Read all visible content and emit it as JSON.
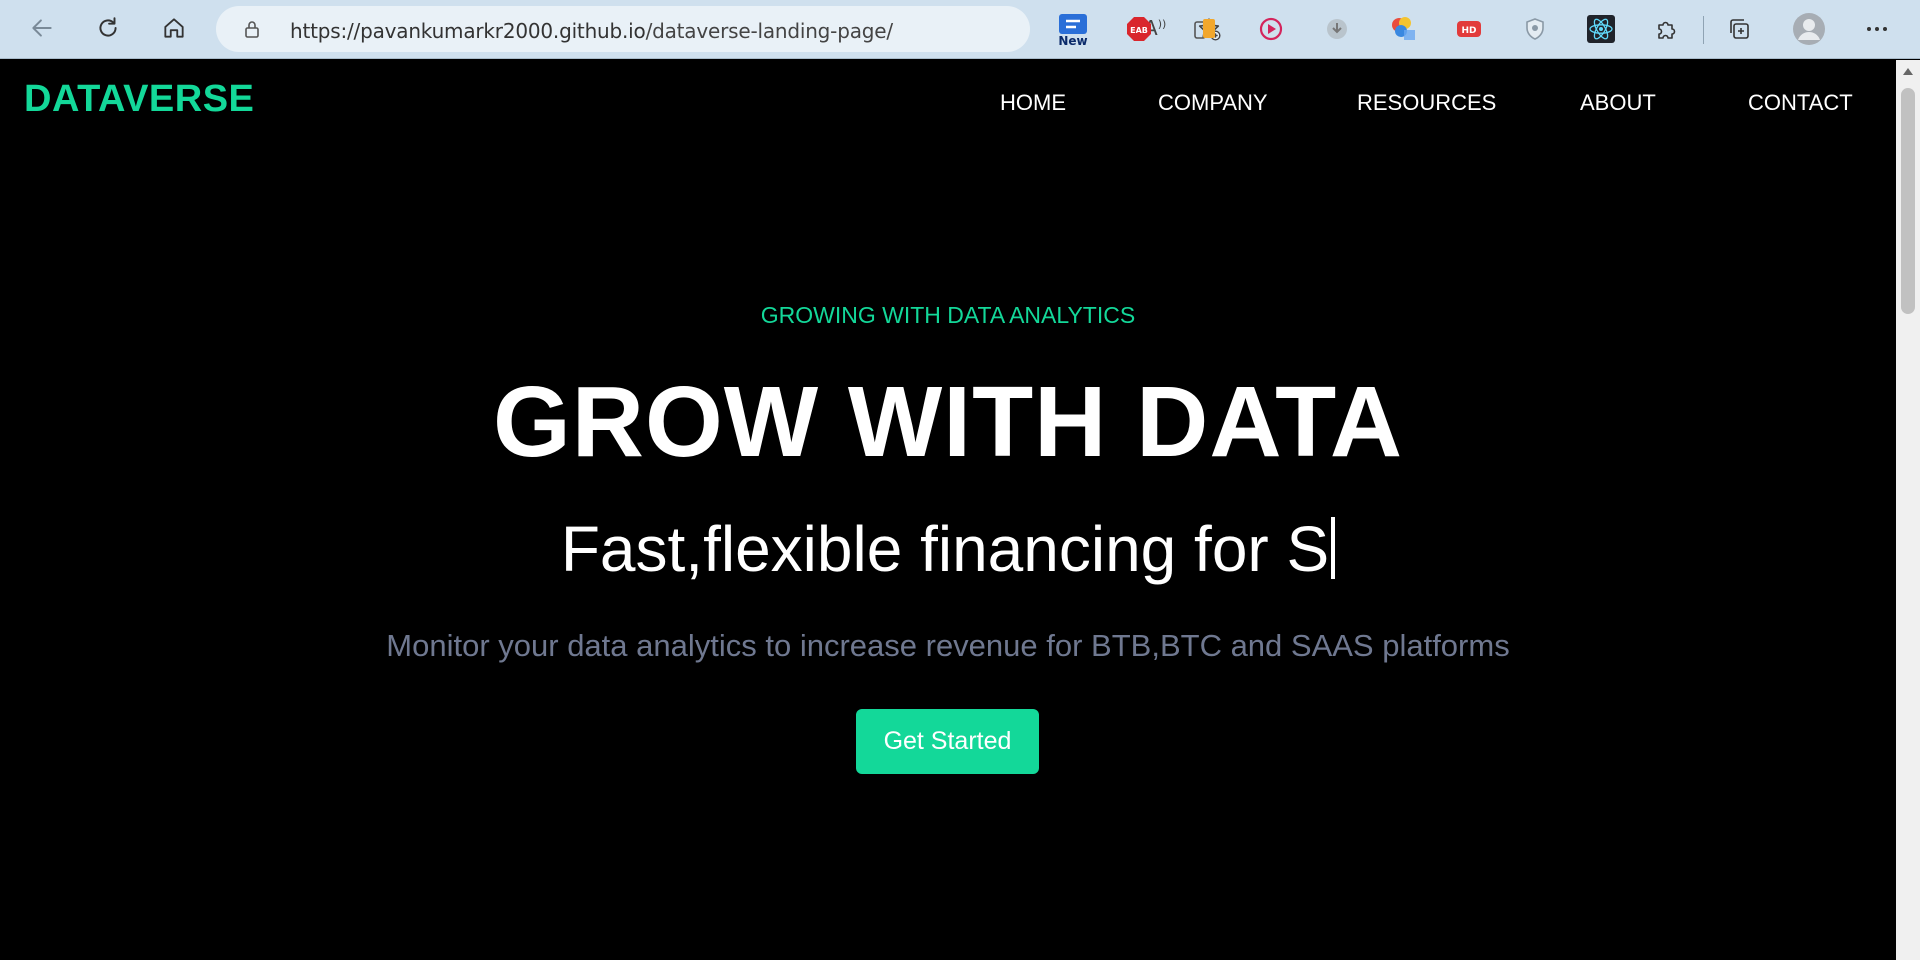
{
  "browser": {
    "url_prefix": "https://pavankumarkr2000.github.io",
    "url_path": "/dataverse-landing-page/",
    "extensions": [
      {
        "name": "new-badge-extension-icon",
        "label": "New"
      },
      {
        "name": "eab-extension-icon",
        "label": "EAB"
      },
      {
        "name": "mobile-view-extension-icon",
        "label": ""
      },
      {
        "name": "video-play-extension-icon",
        "label": ""
      },
      {
        "name": "download-extension-icon",
        "label": ""
      },
      {
        "name": "color-picker-extension-icon",
        "label": ""
      },
      {
        "name": "hd-extension-icon",
        "label": "HD"
      },
      {
        "name": "privacy-badger-extension-icon",
        "label": ""
      },
      {
        "name": "react-devtools-extension-icon",
        "label": ""
      },
      {
        "name": "extensions-puzzle-icon",
        "label": ""
      },
      {
        "name": "collections-icon",
        "label": ""
      },
      {
        "name": "profile-avatar-icon",
        "label": ""
      },
      {
        "name": "more-menu-icon",
        "label": ""
      }
    ]
  },
  "nav": {
    "logo": "DATAVERSE",
    "items": [
      "HOME",
      "COMPANY",
      "RESOURCES",
      "ABOUT",
      "CONTACT"
    ]
  },
  "hero": {
    "eyebrow": "GROWING WITH DATA ANALYTICS",
    "headline": "GROW WITH DATA",
    "typed_text": "Fast,flexible financing for S",
    "subtitle": "Monitor your data analytics to increase revenue for BTB,BTC and SAAS platforms",
    "cta_label": "Get Started"
  },
  "colors": {
    "accent": "#13d899",
    "background": "#000000",
    "subtitle": "#6f7890"
  }
}
